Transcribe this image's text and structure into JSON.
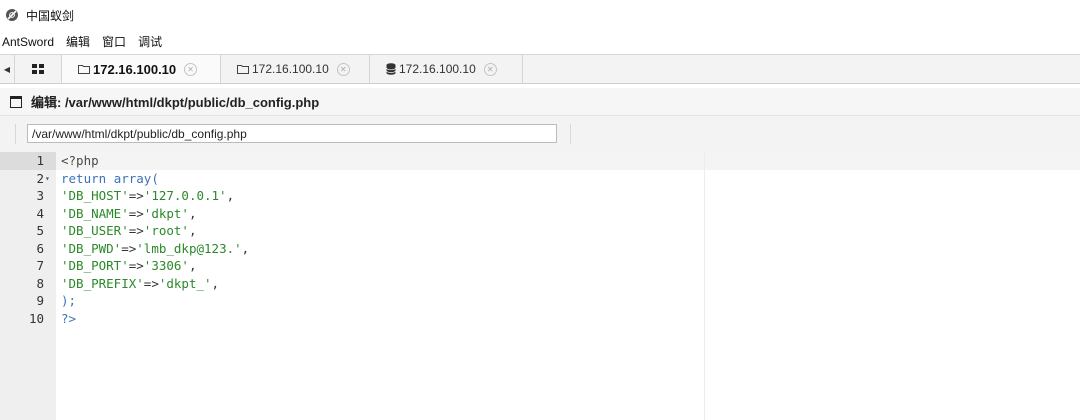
{
  "window": {
    "title": "中国蚁剑"
  },
  "menu": [
    "AntSword",
    "编辑",
    "窗口",
    "调试"
  ],
  "tabs": [
    {
      "label": "172.16.100.10",
      "icon": "folder-icon",
      "active": true
    },
    {
      "label": "172.16.100.10",
      "icon": "folder-icon",
      "active": false
    },
    {
      "label": "172.16.100.10",
      "icon": "database-icon",
      "active": false
    }
  ],
  "panel": {
    "title": "编辑: /var/www/html/dkpt/public/db_config.php"
  },
  "pathbar": {
    "path": "/var/www/html/dkpt/public/db_config.php"
  },
  "code": {
    "lines": [
      {
        "n": "1",
        "tokens": [
          [
            "tag",
            "<?php"
          ]
        ]
      },
      {
        "n": "2",
        "fold": "▾",
        "tokens": [
          [
            "kw",
            "return"
          ],
          [
            "op",
            " "
          ],
          [
            "kw",
            "array("
          ]
        ]
      },
      {
        "n": "3",
        "tokens": [
          [
            "str",
            "'DB_HOST'"
          ],
          [
            "op",
            "=>"
          ],
          [
            "str",
            "'127.0.0.1'"
          ],
          [
            "op",
            ","
          ]
        ]
      },
      {
        "n": "4",
        "tokens": [
          [
            "str",
            "'DB_NAME'"
          ],
          [
            "op",
            "=>"
          ],
          [
            "str",
            "'dkpt'"
          ],
          [
            "op",
            ","
          ]
        ]
      },
      {
        "n": "5",
        "tokens": [
          [
            "str",
            "'DB_USER'"
          ],
          [
            "op",
            "=>"
          ],
          [
            "str",
            "'root'"
          ],
          [
            "op",
            ","
          ]
        ]
      },
      {
        "n": "6",
        "tokens": [
          [
            "str",
            "'DB_PWD'"
          ],
          [
            "op",
            "=>"
          ],
          [
            "str",
            "'lmb_dkp@123.'"
          ],
          [
            "op",
            ","
          ]
        ]
      },
      {
        "n": "7",
        "tokens": [
          [
            "str",
            "'DB_PORT'"
          ],
          [
            "op",
            "=>"
          ],
          [
            "str",
            "'3306'"
          ],
          [
            "op",
            ","
          ]
        ]
      },
      {
        "n": "8",
        "tokens": [
          [
            "str",
            "'DB_PREFIX'"
          ],
          [
            "op",
            "=>"
          ],
          [
            "str",
            "'dkpt_'"
          ],
          [
            "op",
            ","
          ]
        ]
      },
      {
        "n": "9",
        "tokens": [
          [
            "kw",
            ");"
          ]
        ]
      },
      {
        "n": "10",
        "tokens": [
          [
            "kw",
            "?>"
          ]
        ]
      }
    ]
  },
  "colors": {
    "keyword": "#3b73b9",
    "string": "#2a8a2a"
  }
}
